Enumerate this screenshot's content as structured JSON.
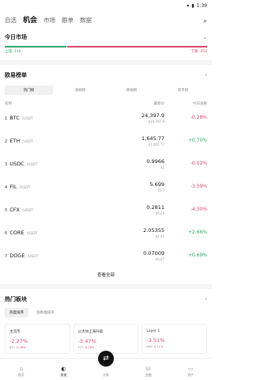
{
  "status_bar": {
    "time": "1:39"
  },
  "top_nav": {
    "tabs": [
      {
        "label": "自选",
        "active": false
      },
      {
        "label": "机会",
        "active": true
      },
      {
        "label": "市场",
        "active": false
      },
      {
        "label": "跟单",
        "active": false
      },
      {
        "label": "数据",
        "active": false
      }
    ]
  },
  "today_market": {
    "title": "今日市场",
    "up_label": "上涨: 110",
    "down_label": "下跌: 252",
    "up_ratio": 0.304
  },
  "rankings": {
    "title": "欧易榜单",
    "sub_tabs": [
      "热门榜",
      "涨幅榜",
      "跌幅榜",
      "新币榜"
    ],
    "headers": {
      "name": "名称",
      "price": "最新价",
      "change": "今日涨跌"
    },
    "rows": [
      {
        "rank": "1",
        "symbol": "BTC",
        "quote": "/USDT",
        "price": "24,397.9",
        "price_sub": "$24,397.9",
        "change": "-0.28%",
        "dir": "neg"
      },
      {
        "rank": "2",
        "symbol": "ETH",
        "quote": "/USDT",
        "price": "1,645.77",
        "price_sub": "$1,645.77",
        "change": "+0.70%",
        "dir": "pos"
      },
      {
        "rank": "3",
        "symbol": "USDC",
        "quote": "/USDT",
        "price": "0.9966",
        "price_sub": "$1",
        "change": "-0.02%",
        "dir": "neg"
      },
      {
        "rank": "4",
        "symbol": "FIL",
        "quote": "/USDT",
        "price": "5.699",
        "price_sub": "$5.7",
        "change": "-3.59%",
        "dir": "neg"
      },
      {
        "rank": "5",
        "symbol": "CFX",
        "quote": "/USDT",
        "price": "0.2811",
        "price_sub": "$0.28",
        "change": "-4.30%",
        "dir": "neg"
      },
      {
        "rank": "6",
        "symbol": "CORE",
        "quote": "/USDT",
        "price": "2.05355",
        "price_sub": "$2.05",
        "change": "+2.66%",
        "dir": "pos"
      },
      {
        "rank": "7",
        "symbol": "DOGE",
        "quote": "/USDT",
        "price": "0.07009",
        "price_sub": "$0.07",
        "change": "+0.69%",
        "dir": "pos"
      }
    ],
    "view_all": "查看全部"
  },
  "hot_sectors": {
    "title": "热门板块",
    "sub_tabs": [
      "热度排序",
      "涨跌幅排序"
    ],
    "cards": [
      {
        "name": "主流币",
        "change": "-2.27%",
        "leader": "BTC",
        "leader_change": "-0.28%"
      },
      {
        "name": "以太坊上海升级",
        "change": "-3.47%",
        "leader": "ETH",
        "leader_change": "-0.26%"
      },
      {
        "name": "Layer 1",
        "change": "-3.51%",
        "leader": "BNB",
        "leader_change": "-0.11%"
      }
    ]
  },
  "bottom_nav": {
    "items": [
      "首页",
      "发现",
      "交易",
      "金融",
      "资产"
    ]
  }
}
